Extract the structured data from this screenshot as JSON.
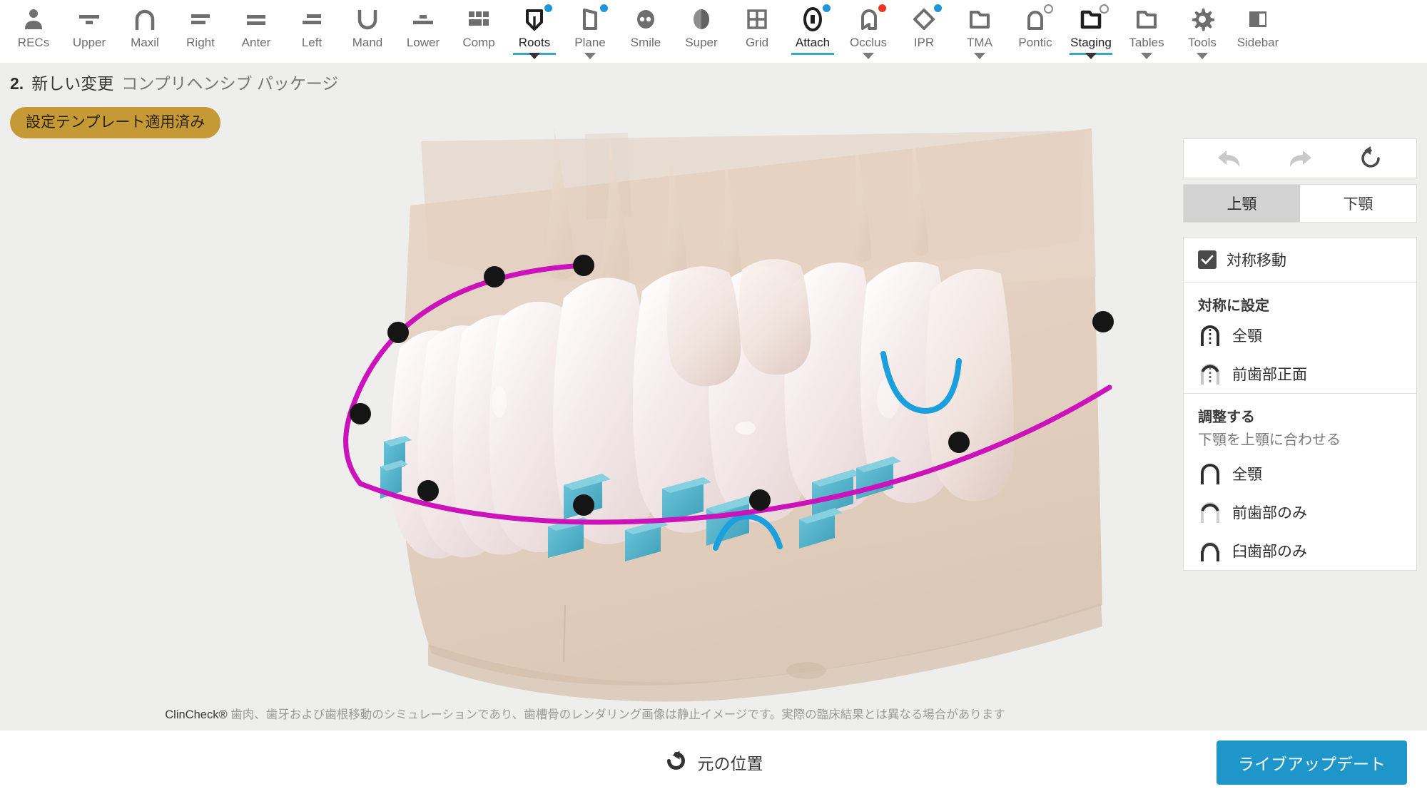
{
  "toolbar": {
    "items": [
      {
        "label": "RECs",
        "icon": "person-icon",
        "active": false,
        "caret": false,
        "badge": "none"
      },
      {
        "label": "Upper",
        "icon": "upper-arch-icon",
        "active": false,
        "caret": false,
        "badge": "none"
      },
      {
        "label": "Maxil",
        "icon": "maxillary-arch-icon",
        "active": false,
        "caret": false,
        "badge": "none"
      },
      {
        "label": "Right",
        "icon": "right-view-icon",
        "active": false,
        "caret": false,
        "badge": "none"
      },
      {
        "label": "Anter",
        "icon": "anterior-view-icon",
        "active": false,
        "caret": false,
        "badge": "none"
      },
      {
        "label": "Left",
        "icon": "left-view-icon",
        "active": false,
        "caret": false,
        "badge": "none"
      },
      {
        "label": "Mand",
        "icon": "mandibular-arch-icon",
        "active": false,
        "caret": false,
        "badge": "none"
      },
      {
        "label": "Lower",
        "icon": "lower-arch-icon",
        "active": false,
        "caret": false,
        "badge": "none"
      },
      {
        "label": "Comp",
        "icon": "compare-grid-icon",
        "active": false,
        "caret": false,
        "badge": "none"
      },
      {
        "label": "Roots",
        "icon": "roots-icon",
        "active": true,
        "caret": true,
        "badge": "blue"
      },
      {
        "label": "Plane",
        "icon": "plane-icon",
        "active": false,
        "caret": true,
        "badge": "blue"
      },
      {
        "label": "Smile",
        "icon": "smile-icon",
        "active": false,
        "caret": false,
        "badge": "none"
      },
      {
        "label": "Super",
        "icon": "superimposition-icon",
        "active": false,
        "caret": false,
        "badge": "none"
      },
      {
        "label": "Grid",
        "icon": "grid-icon",
        "active": false,
        "caret": false,
        "badge": "none"
      },
      {
        "label": "Attach",
        "icon": "attachment-icon",
        "active": true,
        "caret": false,
        "badge": "blue"
      },
      {
        "label": "Occlus",
        "icon": "occlusion-icon",
        "active": false,
        "caret": true,
        "badge": "red"
      },
      {
        "label": "IPR",
        "icon": "ipr-diamond-icon",
        "active": false,
        "caret": false,
        "badge": "blue"
      },
      {
        "label": "TMA",
        "icon": "tma-folder-icon",
        "active": false,
        "caret": true,
        "badge": "none"
      },
      {
        "label": "Pontic",
        "icon": "pontic-icon",
        "active": false,
        "caret": false,
        "badge": "ring"
      },
      {
        "label": "Staging",
        "icon": "staging-folder-icon",
        "active": true,
        "caret": true,
        "badge": "ring"
      },
      {
        "label": "Tables",
        "icon": "tables-folder-icon",
        "active": false,
        "caret": true,
        "badge": "none"
      },
      {
        "label": "Tools",
        "icon": "gear-icon",
        "active": false,
        "caret": true,
        "badge": "none"
      },
      {
        "label": "Sidebar",
        "icon": "sidebar-icon",
        "active": false,
        "caret": false,
        "badge": "none"
      }
    ]
  },
  "stage": {
    "title_number": "2.",
    "title_main": "新しい変更",
    "title_sub": "コンプリヘンシブ パッケージ",
    "template_badge": "設定テンプレート適用済み",
    "disclaimer_brand": "ClinCheck®",
    "disclaimer_text": "歯肉、歯牙および歯根移動のシミュレーションであり、歯槽骨のレンダリング画像は静止イメージです。実際の臨床結果とは異なる場合があります"
  },
  "sidebar": {
    "history": [
      {
        "name": "undo-icon",
        "title": "元に戻す"
      },
      {
        "name": "redo-icon",
        "title": "やり直し"
      },
      {
        "name": "reset-icon",
        "title": "リセット"
      }
    ],
    "arch_tabs": [
      {
        "label": "上顎",
        "selected": true
      },
      {
        "label": "下顎",
        "selected": false
      }
    ],
    "symmetric_move": {
      "label": "対称移動",
      "checked": true
    },
    "set_symmetric": {
      "title": "対称に設定",
      "items": [
        {
          "label": "全顎",
          "icon": "arch-full-dashed-icon"
        },
        {
          "label": "前歯部正面",
          "icon": "arch-anterior-dashed-icon"
        }
      ]
    },
    "adjust": {
      "title": "調整する",
      "subtitle": "下顎を上顎に合わせる",
      "items": [
        {
          "label": "全顎",
          "icon": "arch-full-icon"
        },
        {
          "label": "前歯部のみ",
          "icon": "arch-anterior-icon"
        },
        {
          "label": "臼歯部のみ",
          "icon": "arch-posterior-icon"
        }
      ]
    }
  },
  "bottom": {
    "reset_label": "元の位置",
    "reset_icon": "reset-position-icon",
    "live_update_label": "ライブアップデート"
  },
  "colors": {
    "accent_blue": "#1f96c9",
    "tab_underline": "#3ba3cf",
    "badge_gold": "#c59a36",
    "badge_red": "#e8342a",
    "badge_blue": "#2196d6",
    "arch_curve_magenta": "#cc12bb",
    "attachment_cyan": "#4cb8d0",
    "marker_black": "#151515",
    "stage_bg": "#eeeeec"
  }
}
